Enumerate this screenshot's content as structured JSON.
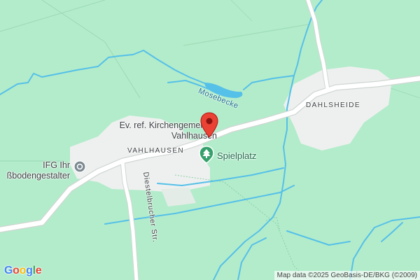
{
  "map": {
    "places": {
      "vahlhausen": "VAHLHAUSEN",
      "dahlsheide": "DAHLSHEIDE"
    },
    "water": {
      "mosebecke": "Mosebecke"
    },
    "streets": {
      "diestelbrucher": "Diestelbrucher Str."
    },
    "pois": {
      "church_line1": "Ev. ref. Kirchengemeinde",
      "church_line2": "Vahlhausen",
      "playground": "Spielplatz",
      "ifg_line1": "IFG Ihr",
      "ifg_line2": "ßbodengestalter"
    },
    "icons": {
      "pin": "red-location-pin",
      "playground": "tree-icon",
      "ifg": "business-icon"
    },
    "colors": {
      "land": "#b3eccb",
      "road": "#ffffff",
      "water": "#55c0e8",
      "pin": "#ea4335",
      "poi_green": "#34a06b"
    },
    "logo": "Google",
    "attribution": "Map data ©2025 GeoBasis-DE/BKG (©2009)"
  }
}
